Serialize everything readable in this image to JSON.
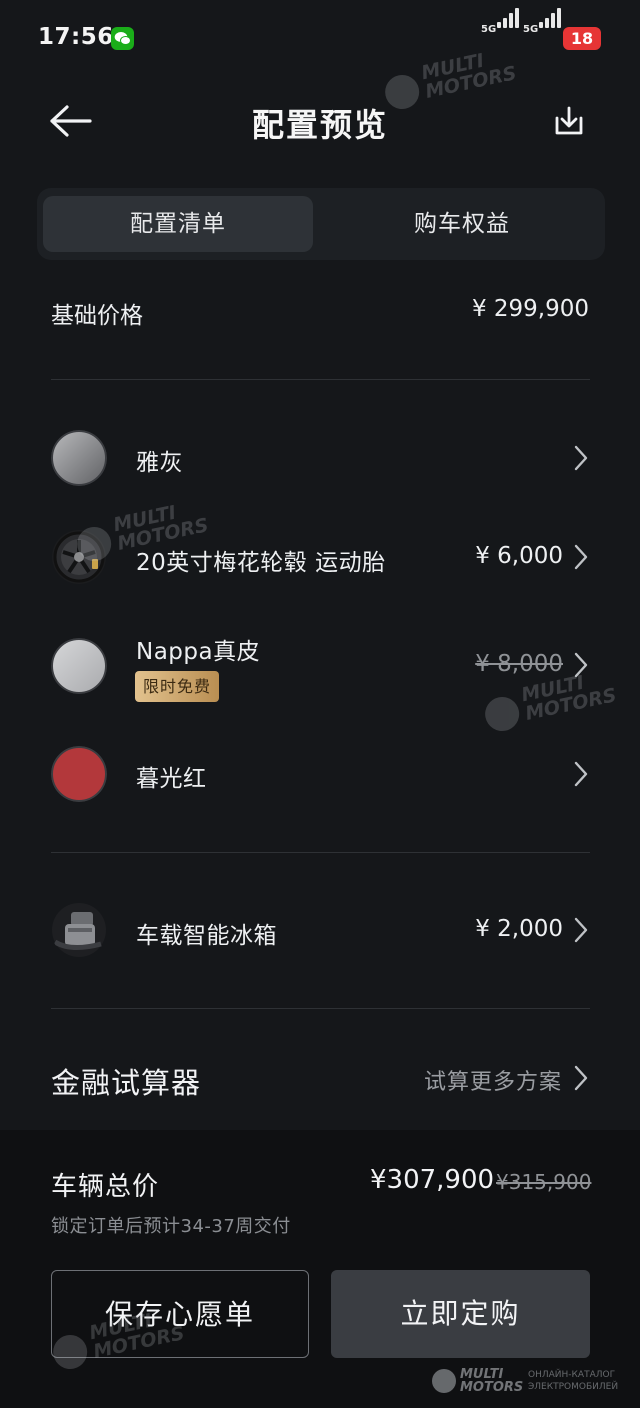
{
  "status_bar": {
    "time": "17:56",
    "network_1": "5G",
    "network_2": "5G",
    "battery": "18",
    "icons": [
      "wechat-icon",
      "signal-icon",
      "battery-icon"
    ]
  },
  "header": {
    "title": "配置预览",
    "icons": [
      "back-arrow-icon",
      "download-icon"
    ]
  },
  "tabs": [
    {
      "label": "配置清单",
      "active": true
    },
    {
      "label": "购车权益",
      "active": false
    }
  ],
  "base_price": {
    "label": "基础价格",
    "value": "¥ 299,900"
  },
  "options": [
    {
      "label": "雅灰",
      "price": "",
      "icon": "gray-paint-swatch-icon",
      "color": "#8e8f91"
    },
    {
      "label": "20英寸梅花轮毂 运动胎",
      "price": "¥ 6,000",
      "icon": "wheel-icon"
    },
    {
      "label": "Nappa真皮",
      "price": "¥ 8,000",
      "price_struck": true,
      "badge": "限时免费",
      "icon": "silver-leather-swatch-icon",
      "color": "#c9cacc"
    },
    {
      "label": "暮光红",
      "price": "",
      "icon": "red-interior-swatch-icon",
      "color": "#b83a3c"
    }
  ],
  "accessory": {
    "label": "车载智能冰箱",
    "price": "¥ 2,000",
    "icon": "car-fridge-icon"
  },
  "finance": {
    "label": "金融试算器",
    "link": "试算更多方案"
  },
  "summary": {
    "total_label": "车辆总价",
    "total_price": "¥307,900",
    "original_price": "¥315,900",
    "delivery_note": "锁定订单后预计34-37周交付"
  },
  "actions": {
    "wishlist_label": "保存心愿单",
    "order_label": "立即定购"
  },
  "watermark": {
    "line1": "MULTI",
    "line2": "MOTORS",
    "footer_line1": "MULTI",
    "footer_line2": "MOTORS",
    "footer_sub1": "ОНЛАЙН-КАТАЛОГ",
    "footer_sub2": "ЭЛЕКТРОМОБИЛЕЙ"
  },
  "colors": {
    "background": "#15171a",
    "panel": "#0f1012",
    "badge_gold": "#d4b07a",
    "battery_red": "#e63535",
    "wechat_green": "#1aad19"
  }
}
